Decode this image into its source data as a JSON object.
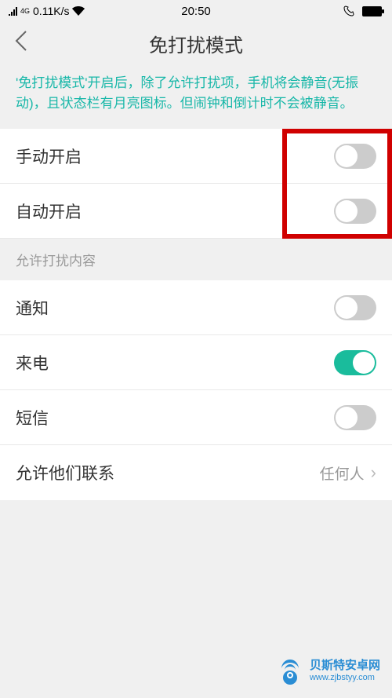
{
  "status_bar": {
    "signal_label": "4G",
    "speed": "0.11K/s",
    "time": "20:50"
  },
  "header": {
    "title": "免打扰模式"
  },
  "description": "'免打扰模式'开启后，除了允许打扰项，手机将会静音(无振动)，且状态栏有月亮图标。但闹钟和倒计时不会被静音。",
  "toggles": {
    "manual": {
      "label": "手动开启",
      "on": false
    },
    "auto": {
      "label": "自动开启",
      "on": false
    }
  },
  "section_header": "允许打扰内容",
  "allow": {
    "notification": {
      "label": "通知",
      "on": false
    },
    "call": {
      "label": "来电",
      "on": true
    },
    "sms": {
      "label": "短信",
      "on": false
    },
    "contact": {
      "label": "允许他们联系",
      "value": "任何人"
    }
  },
  "watermark": {
    "title": "贝斯特安卓网",
    "url": "www.zjbstyy.com"
  }
}
